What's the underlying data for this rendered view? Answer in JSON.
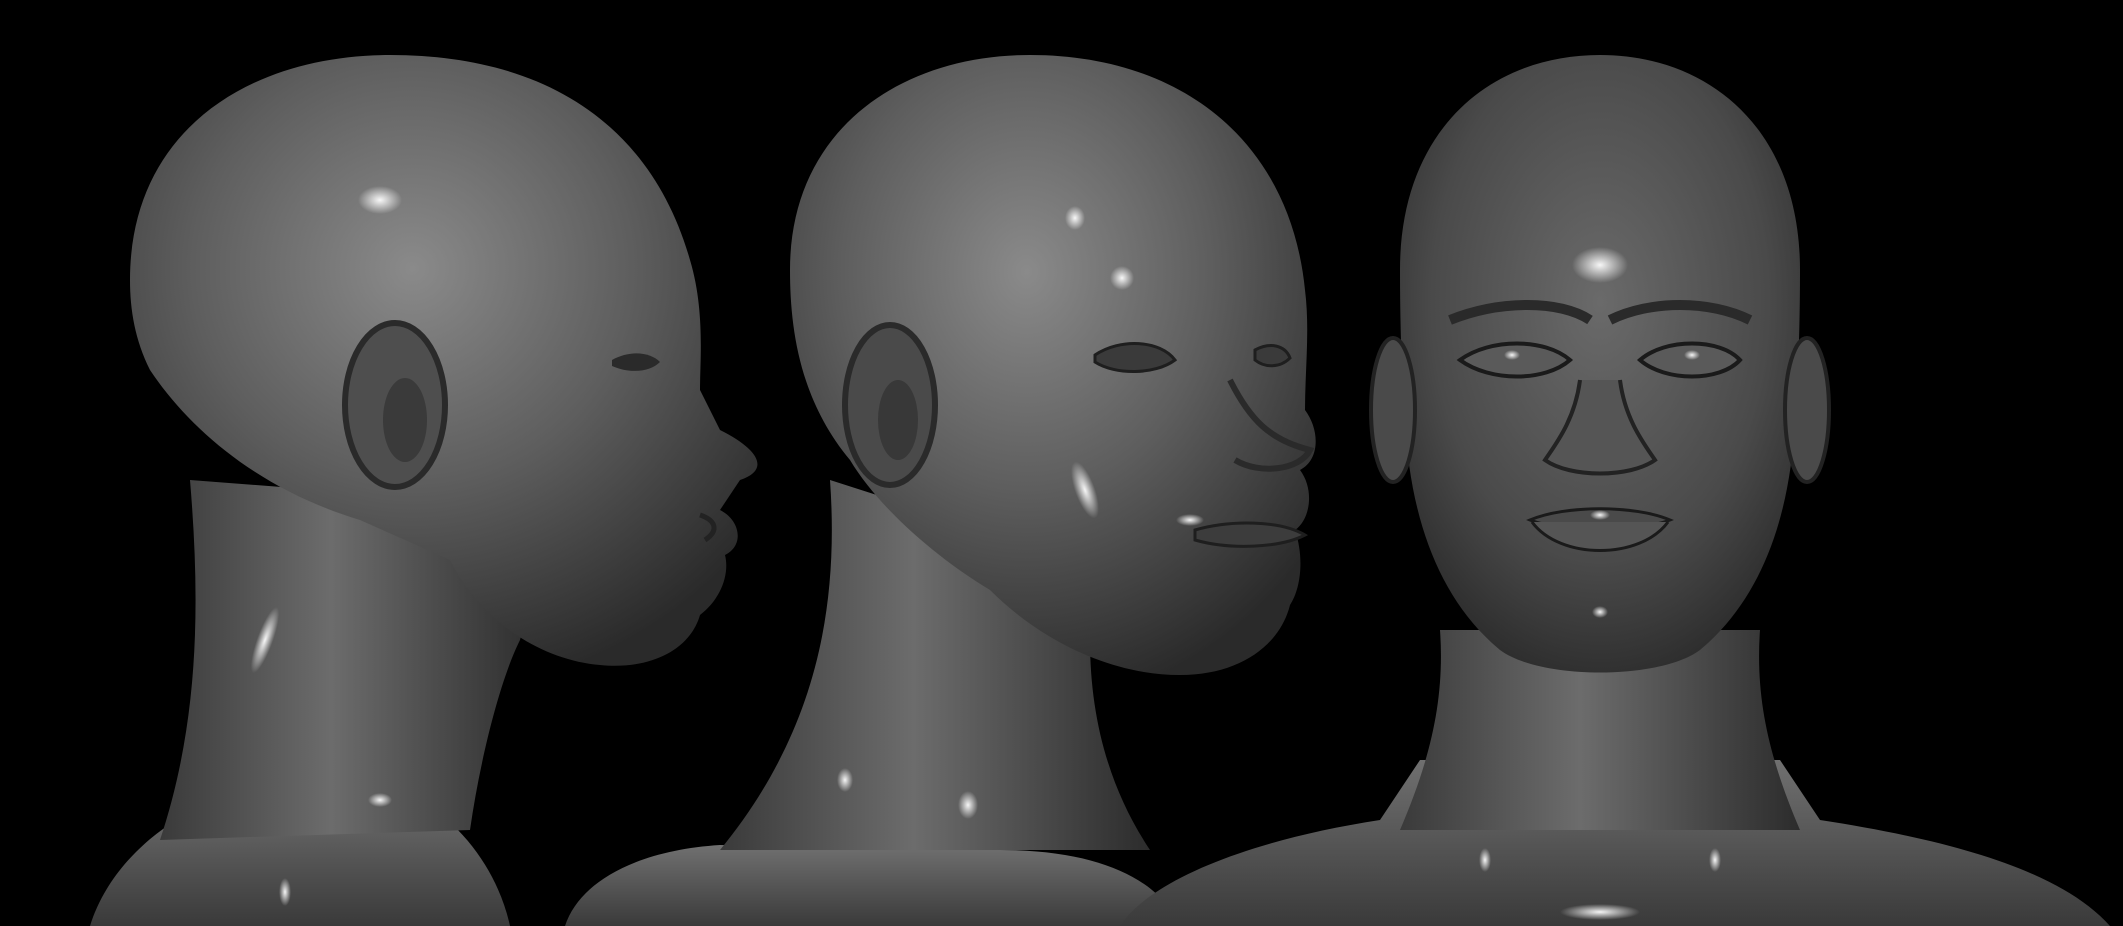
{
  "scene": {
    "background_color": "#000000",
    "material_color": "#6e6e6e",
    "highlight_color": "#f2f2f2",
    "shadow_color": "#1a1a1a",
    "views": [
      {
        "name": "profile-view",
        "orientation": "side"
      },
      {
        "name": "three-quarter-view",
        "orientation": "three-quarter"
      },
      {
        "name": "front-view",
        "orientation": "front"
      }
    ]
  }
}
